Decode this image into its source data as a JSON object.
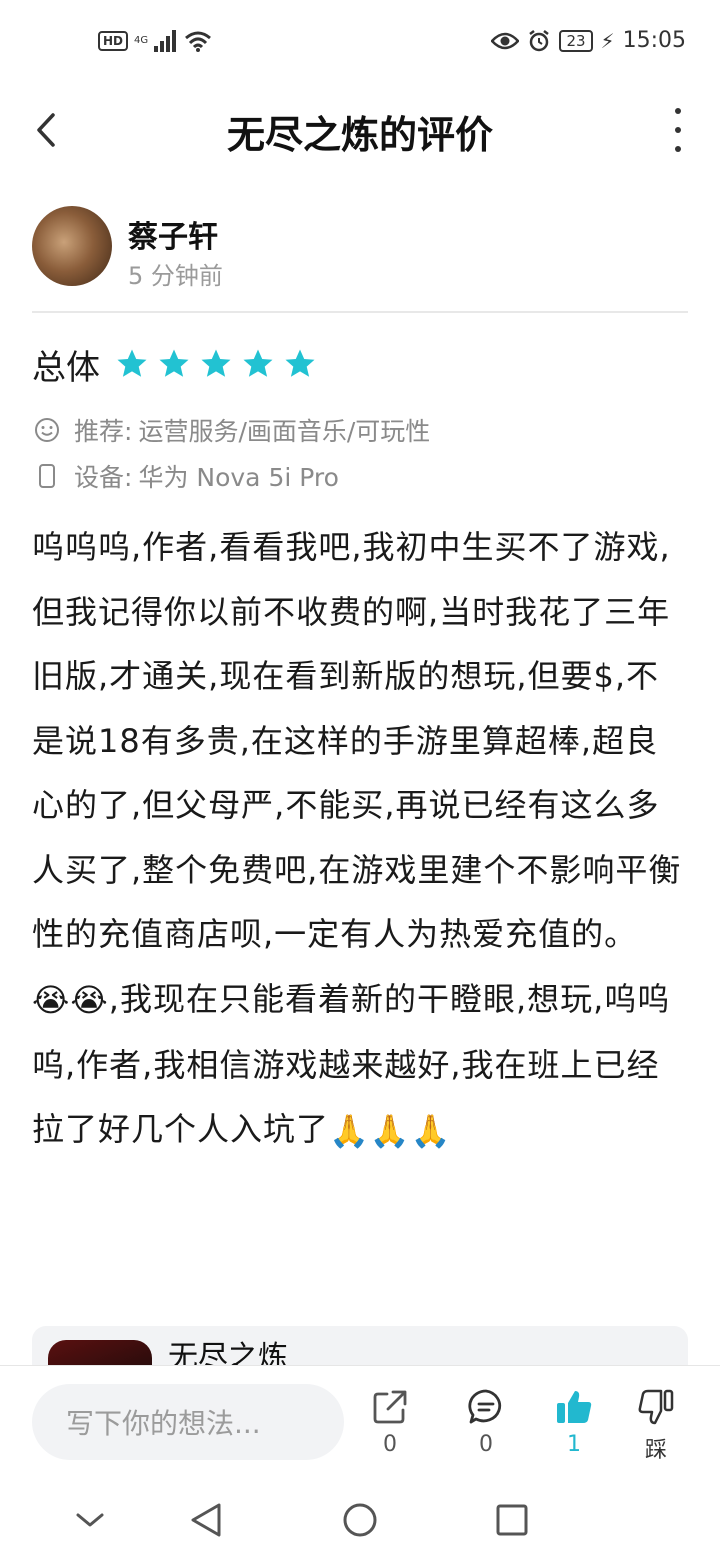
{
  "status_bar": {
    "hd": "HD",
    "network": "4G",
    "battery": "23",
    "time": "15:05"
  },
  "header": {
    "title": "无尽之炼的评价"
  },
  "review": {
    "author_name": "蔡子轩",
    "posted_time": "5 分钟前",
    "rating_label": "总体",
    "rating_stars": 5,
    "rating_max": 5,
    "recommend_label": "推荐:",
    "recommend_value": "运营服务/画面音乐/可玩性",
    "device_label": "设备:",
    "device_value": "华为 Nova 5i Pro",
    "body_part1": "呜呜呜,作者,看看我吧,我初中生买不了游戏,但我记得你以前不收费的啊,当时我花了三年旧版,才通关,现在看到新版的想玩,但要$,不是说18有多贵,在这样的手游里算超棒,超良心的了,但父母严,不能买,再说已经有这么多人买了,整个免费吧,在游戏里建个不影响平衡性的充值商店呗,一定有人为热爱充值的。",
    "body_emoji1": "😭😭",
    "body_part2": ",我现在只能看着新的干瞪眼,想玩,呜呜呜,作者,我相信游戏越来越好,我在班上已经拉了好几个人入坑了",
    "body_emoji2": "🙏🙏🙏"
  },
  "game_card": {
    "name": "无尽之炼"
  },
  "bottom_bar": {
    "comment_placeholder": "写下你的想法...",
    "share_count": "0",
    "comment_count": "0",
    "like_count": "1",
    "dislike_label": "踩"
  },
  "colors": {
    "star": "#22c2d2",
    "like_active": "#22b8cf",
    "text": "#1a1a1a",
    "muted": "#9a9a9a"
  }
}
